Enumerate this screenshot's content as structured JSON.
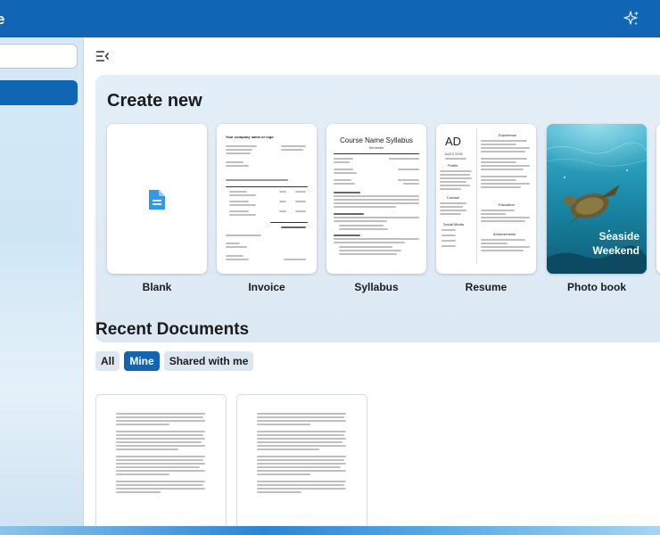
{
  "app": {
    "title_fragment": "e"
  },
  "create_new": {
    "title": "Create new",
    "templates": [
      {
        "label": "Blank"
      },
      {
        "label": "Invoice",
        "preview_heading": "Your company name or logo"
      },
      {
        "label": "Syllabus",
        "preview_heading": "Course Name Syllabus",
        "preview_sub": "Semester"
      },
      {
        "label": "Resume",
        "preview_initials": "AD",
        "preview_name": "ALEX DOE",
        "preview_sections": [
          "Profile",
          "Contact",
          "Social Media",
          "Experience",
          "Education",
          "Achievements"
        ]
      },
      {
        "label": "Photo book",
        "preview_text_line1": "Seaside",
        "preview_text_line2": "Weekend"
      }
    ]
  },
  "recent": {
    "title": "Recent Documents",
    "filters": [
      {
        "label": "All",
        "active": false
      },
      {
        "label": "Mine",
        "active": true
      },
      {
        "label": "Shared with me",
        "active": false
      }
    ]
  },
  "colors": {
    "accent": "#1066b4",
    "blank_icon": "#2b9bea"
  },
  "icons": {
    "copilot": "sparkle-icon",
    "collapse": "collapse-sidebar-icon",
    "blank_doc": "document-icon"
  }
}
